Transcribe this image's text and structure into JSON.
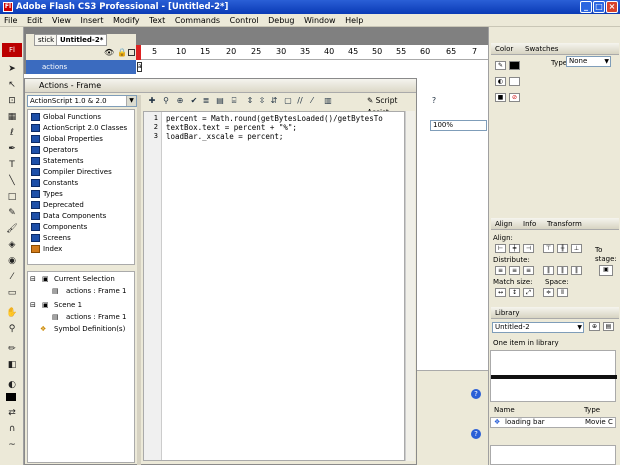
{
  "window": {
    "title": "Adobe Flash CS3 Professional - [Untitled-2*]"
  },
  "menu": [
    "File",
    "Edit",
    "View",
    "Insert",
    "Modify",
    "Text",
    "Commands",
    "Control",
    "Debug",
    "Window",
    "Help"
  ],
  "doc_tabs": [
    "stick",
    "Untitled-2*"
  ],
  "timeline": {
    "layer_name": "actions",
    "ruler": [
      "5",
      "10",
      "15",
      "20",
      "25",
      "30",
      "35",
      "40",
      "45",
      "50",
      "55",
      "60",
      "65",
      "7"
    ]
  },
  "actions_panel": {
    "title": "Actions - Frame",
    "version_select": "ActionScript 1.0 & 2.0",
    "books": [
      "Global Functions",
      "ActionScript 2.0 Classes",
      "Global Properties",
      "Operators",
      "Statements",
      "Compiler Directives",
      "Constants",
      "Types",
      "Deprecated",
      "Data Components",
      "Components",
      "Screens",
      "Index"
    ],
    "tree": {
      "current_selection": "Current Selection",
      "cs_frame": "actions : Frame 1",
      "scene": "Scene 1",
      "scene_frame": "actions : Frame 1",
      "symbols": "Symbol Definition(s)"
    },
    "script_assist": "Script Assist",
    "code_lines": [
      {
        "n": "1",
        "text": "percent = Math.round(getBytesLoaded()/getBytesTo"
      },
      {
        "n": "2",
        "text": "textBox.text = percent + \"%\";"
      },
      {
        "n": "3",
        "text": "loadBar._xscale = percent;"
      }
    ]
  },
  "zoom": "100%",
  "color_panel": {
    "tabs": [
      "Color",
      "Swatches"
    ],
    "type_label": "Type:",
    "type_value": "None"
  },
  "align_panel": {
    "tabs": [
      "Align",
      "Info",
      "Transform"
    ],
    "align_label": "Align:",
    "distribute_label": "Distribute:",
    "match_size_label": "Match size:",
    "space_label": "Space:",
    "to_stage_label": "To stage:"
  },
  "library_panel": {
    "tab": "Library",
    "document": "Untitled-2",
    "count_text": "One item in library",
    "col_name": "Name",
    "col_type": "Type",
    "item_name": "loading bar",
    "item_type": "Movie C"
  }
}
